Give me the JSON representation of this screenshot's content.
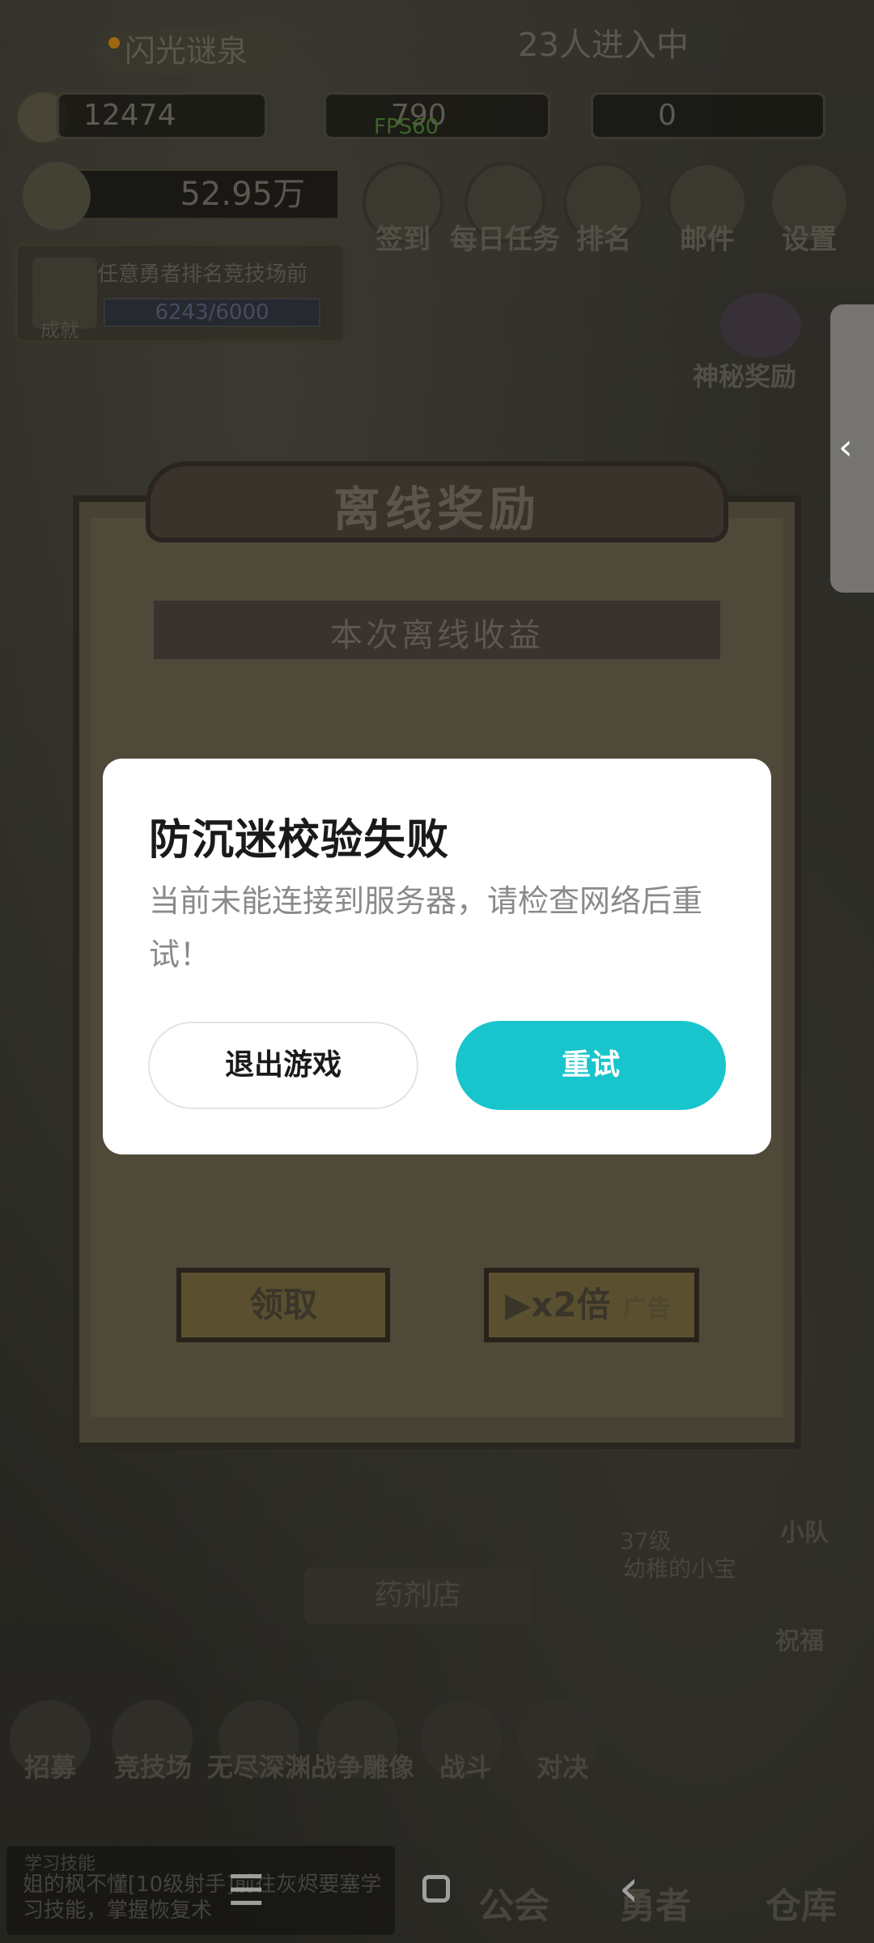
{
  "top": {
    "server_name": "闪光谜泉",
    "online_count": "23人进入中",
    "resources": [
      "12474",
      "790",
      "0"
    ],
    "fps": "FPS60",
    "power": "52.95万"
  },
  "top_menu": [
    "签到",
    "每日任务",
    "排名",
    "邮件",
    "设置"
  ],
  "quest": {
    "text": "任意勇者排名竞技场前",
    "progress": "6243/6000",
    "badge": "成就"
  },
  "mystery_reward": "神秘奖励",
  "offline_panel": {
    "title": "离线奖励",
    "subtitle": "本次离线收益",
    "claim_label": "领取",
    "double_label": "▶x2倍",
    "ad_label": "广告"
  },
  "modal": {
    "title": "防沉迷校验失败",
    "message": "当前未能连接到服务器，请检查网络后重试！",
    "exit_label": "退出游戏",
    "retry_label": "重试"
  },
  "side_items": [
    "小队",
    "祝福"
  ],
  "hero_info": {
    "level": "37级",
    "name": "幼稚的小宝"
  },
  "shop_banner": "药剂店",
  "bottom_nav": [
    "招募",
    "竞技场",
    "无尽深渊",
    "战争雕像",
    "战斗",
    "对决"
  ],
  "bottom_extra": [
    "公会",
    "勇者",
    "仓库"
  ],
  "chat": {
    "title": "学习技能",
    "text": "姐的枫不懂[10级射手]前往灰烬要塞学习技能，掌握恢复术"
  },
  "colors": {
    "accent": "#19c5cc",
    "dot": "#f4a019"
  }
}
